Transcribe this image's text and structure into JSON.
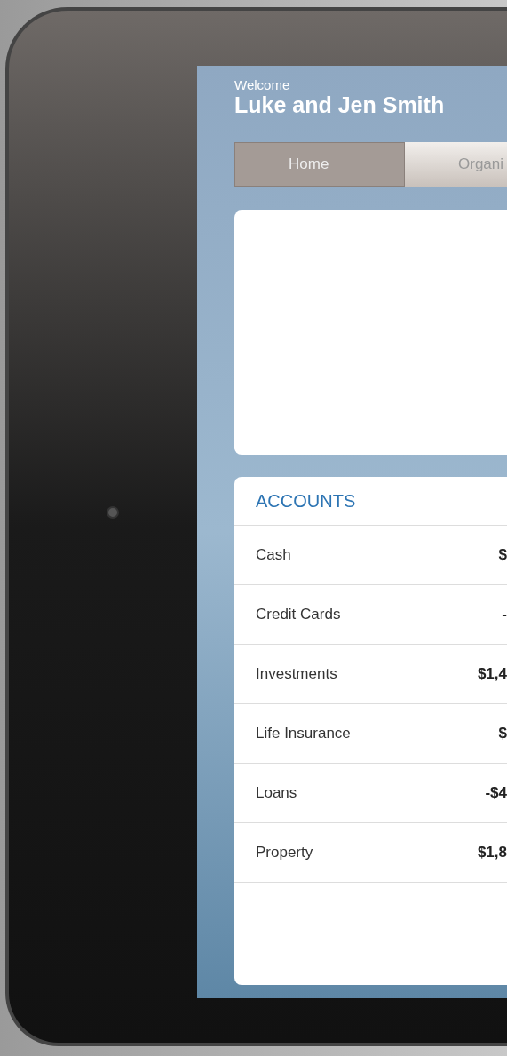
{
  "header": {
    "greeting": "Welcome",
    "name": "Luke and Jen Smith"
  },
  "tabs": [
    {
      "label": "Home",
      "selected": true
    },
    {
      "label": "Organi",
      "selected": false
    }
  ],
  "accounts": {
    "title": "ACCOUNTS",
    "rows": [
      {
        "label": "Cash",
        "value": "$"
      },
      {
        "label": "Credit Cards",
        "value": "-"
      },
      {
        "label": "Investments",
        "value": "$1,4"
      },
      {
        "label": "Life Insurance",
        "value": "$"
      },
      {
        "label": "Loans",
        "value": "-$4"
      },
      {
        "label": "Property",
        "value": "$1,8"
      }
    ]
  }
}
